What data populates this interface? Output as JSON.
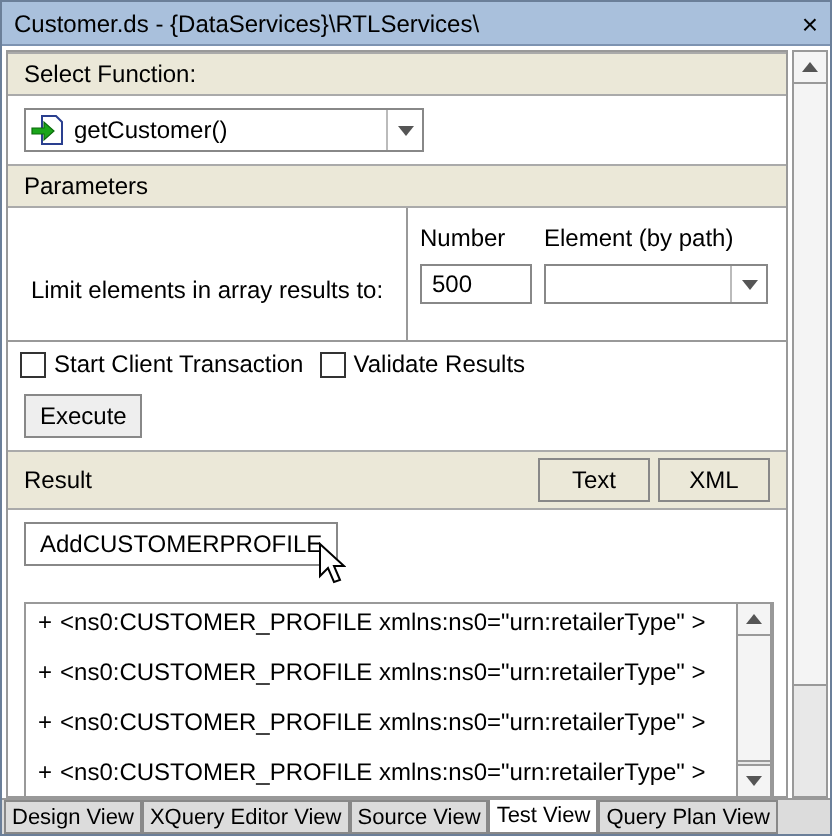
{
  "window": {
    "title": "Customer.ds - {DataServices}\\RTLServices\\",
    "close": "×"
  },
  "select_function": {
    "header": "Select Function:",
    "value": "getCustomer()"
  },
  "parameters": {
    "header": "Parameters",
    "label": "Limit elements in array results to:",
    "number_label": "Number",
    "number_value": "500",
    "element_label": "Element (by path)"
  },
  "options": [
    {
      "label": "Start Client Transaction",
      "checked": false
    },
    {
      "label": "Validate Results",
      "checked": false
    }
  ],
  "execute": "Execute",
  "result": {
    "header": "Result",
    "views": [
      {
        "label": "Text",
        "selected": false
      },
      {
        "label": "XML",
        "selected": false
      }
    ],
    "root_button": "AddCUSTOMERPROFILE",
    "lines": [
      {
        "expander": "+",
        "text": "<ns0:CUSTOMER_PROFILE xmlns:ns0=\"urn:retailerType\" >"
      },
      {
        "expander": "+",
        "text": "<ns0:CUSTOMER_PROFILE xmlns:ns0=\"urn:retailerType\" >"
      },
      {
        "expander": "+",
        "text": "<ns0:CUSTOMER_PROFILE xmlns:ns0=\"urn:retailerType\" >"
      },
      {
        "expander": "+",
        "text": "<ns0:CUSTOMER_PROFILE xmlns:ns0=\"urn:retailerType\" >"
      }
    ]
  },
  "tabs": [
    {
      "label": "Design View",
      "selected": false
    },
    {
      "label": "XQuery Editor View",
      "selected": false
    },
    {
      "label": "Source View",
      "selected": false
    },
    {
      "label": "Test View",
      "selected": true
    },
    {
      "label": "Query Plan View",
      "selected": false
    }
  ]
}
